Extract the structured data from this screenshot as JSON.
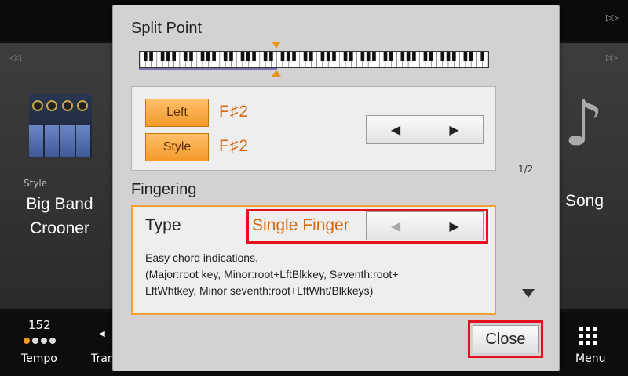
{
  "background": {
    "style_category": "Style",
    "style_name_line1": "Big Band",
    "style_name_line2": "Crooner",
    "song_label": "Song",
    "bottom_bar": {
      "tempo_value": "152",
      "tempo_label": "Tempo",
      "transpose_label_partial": "Tran",
      "menu_label": "Menu"
    }
  },
  "dialog": {
    "split_point": {
      "title": "Split Point",
      "left_button": "Left",
      "left_value": "F♯2",
      "style_button": "Style",
      "style_value": "F♯2",
      "prev_icon": "triangle-left-icon",
      "next_icon": "triangle-right-icon"
    },
    "page_indicator": "1/2",
    "fingering": {
      "title": "Fingering",
      "type_label": "Type",
      "type_value": "Single Finger",
      "description_line1": "Easy chord indications.",
      "description_line2": "(Major:root key, Minor:root+LftBlkkey, Seventh:root+",
      "description_line3": "LftWhtkey, Minor seventh:root+LftWht/Blkkeys)"
    },
    "close_label": "Close"
  },
  "colors": {
    "accent_orange": "#f39a2a",
    "value_text": "#d46a12",
    "highlight_red": "#e4101c",
    "dialog_bg": "#d4d1d3"
  }
}
